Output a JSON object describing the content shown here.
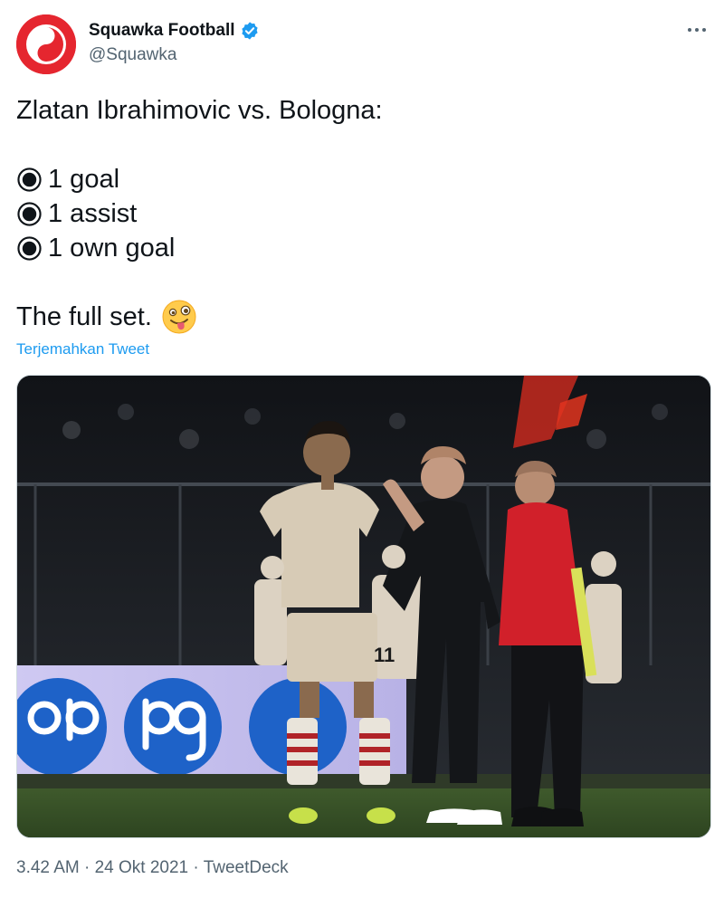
{
  "tweet": {
    "author": {
      "display_name": "Squawka Football",
      "handle": "@Squawka",
      "avatar_icon": "squawka-logo",
      "verified_icon": "verified-badge-icon",
      "brand_color": "#e5262f"
    },
    "more_icon": "more-icon",
    "text_lines": {
      "line1": "Zlatan Ibrahimovic vs. Bologna:",
      "bullet1": "1 goal",
      "bullet2": "1 assist",
      "bullet3": "1 own goal",
      "closing": "The full set."
    },
    "bullet_icon": "radio-button-icon",
    "emoji_icon": "winking-tongue-emoji",
    "translate_label": "Terjemahkan Tweet",
    "media_icon": "football-match-photo",
    "footer": {
      "time": "3.42 AM",
      "separator": " · ",
      "date": "24 Okt 2021",
      "source": "TweetDeck"
    },
    "colors": {
      "link": "#1d9bf0",
      "text": "#0f1419",
      "secondary": "#536471"
    }
  }
}
